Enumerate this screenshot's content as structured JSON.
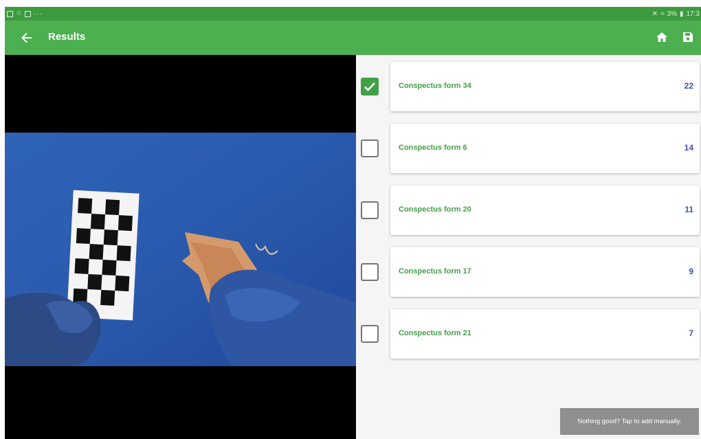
{
  "status_bar": {
    "left_icons": [
      "image-icon",
      "star-icon",
      "gallery-icon",
      "more-dots-icon"
    ],
    "right_text": "3%",
    "time": "17:3"
  },
  "app_bar": {
    "title": "Results",
    "back_icon": "arrow-back-icon",
    "home_icon": "home-icon",
    "save_icon": "save-icon",
    "color": "#4caf50"
  },
  "results": [
    {
      "label": "Conspectus form 34",
      "count": "22",
      "checked": true
    },
    {
      "label": "Conspectus form 6",
      "count": "14",
      "checked": false
    },
    {
      "label": "Conspectus form 20",
      "count": "11",
      "checked": false
    },
    {
      "label": "Conspectus form 17",
      "count": "9",
      "checked": false
    },
    {
      "label": "Conspectus form 21",
      "count": "7",
      "checked": false
    }
  ],
  "snackbar": {
    "text": "Nothing good? Tap to add manually."
  },
  "colors": {
    "status_bar": "#3d9b3f",
    "label_green": "#43a047",
    "count_blue": "#3f51b5"
  }
}
